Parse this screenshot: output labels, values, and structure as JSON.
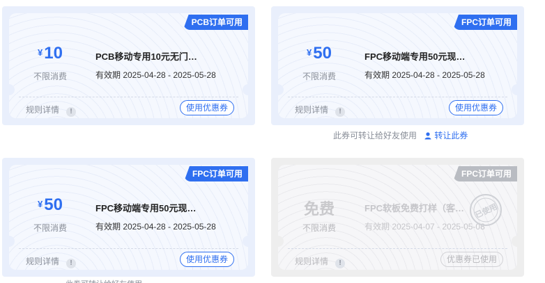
{
  "cards": [
    {
      "tag": "PCB订单可用",
      "currency": "¥",
      "amount": "10",
      "condition": "不限消费",
      "title": "PCB移动专用10元无门…",
      "validity": "有效期 2025-04-28 - 2025-05-28",
      "rules_label": "规则详情",
      "rules_icon": "!",
      "action_label": "使用优惠券",
      "state": "active"
    },
    {
      "tag": "FPC订单可用",
      "currency": "¥",
      "amount": "50",
      "condition": "不限消费",
      "title": "FPC移动端专用50元现…",
      "validity": "有效期 2025-04-28 - 2025-05-28",
      "rules_label": "规则详情",
      "rules_icon": "!",
      "action_label": "使用优惠券",
      "state": "active"
    },
    {
      "tag": "FPC订单可用",
      "currency": "¥",
      "amount": "50",
      "condition": "不限消费",
      "title": "FPC移动端专用50元现…",
      "validity": "有效期 2025-04-28 - 2025-05-28",
      "rules_label": "规则详情",
      "rules_icon": "!",
      "action_label": "使用优惠券",
      "state": "active"
    },
    {
      "tag": "FPC订单可用",
      "amount": "免费",
      "condition": "不限消费",
      "title": "FPC软板免费打样（客…",
      "validity": "有效期 2025-04-07 - 2025-05-08",
      "rules_label": "规则详情",
      "rules_icon": "!",
      "action_label": "优惠券已使用",
      "stamp_text": "已使用",
      "state": "used"
    }
  ],
  "transfer": {
    "note": "此券可转让给好友使用",
    "link": "转让此券",
    "icon": "user-icon"
  },
  "colors": {
    "accent": "#2f6ff0",
    "card_bg": "#e9effc",
    "used_gray": "#b9bcc2"
  }
}
